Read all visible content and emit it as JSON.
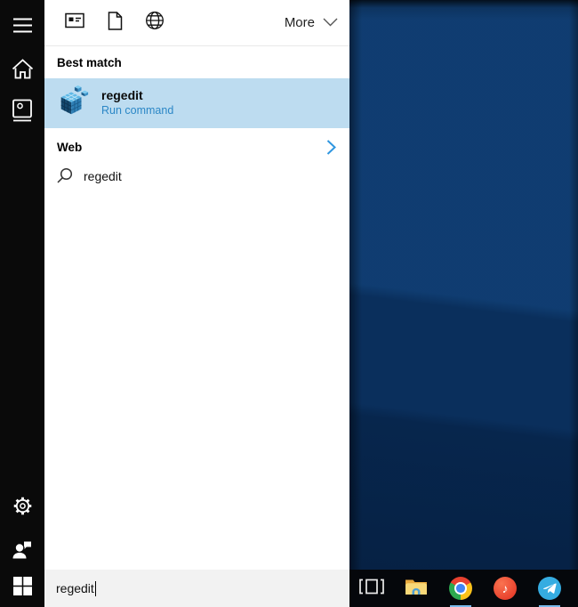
{
  "sidebar": {
    "items": [
      {
        "name": "menu",
        "icon": "hamburger-icon"
      },
      {
        "name": "home",
        "icon": "home-icon"
      },
      {
        "name": "notebook",
        "icon": "notebook-icon"
      },
      {
        "name": "settings",
        "icon": "gear-icon"
      },
      {
        "name": "feedback",
        "icon": "feedback-icon"
      }
    ],
    "start": {
      "name": "start",
      "icon": "windows-logo-icon"
    }
  },
  "topbar": {
    "filters": [
      {
        "icon": "apps-filter-icon"
      },
      {
        "icon": "documents-filter-icon"
      },
      {
        "icon": "web-filter-icon"
      }
    ],
    "more_label": "More",
    "more_icon": "chevron-down-icon"
  },
  "results": {
    "best_match_header": "Best match",
    "best_match": {
      "icon": "registry-editor-icon",
      "title": "regedit",
      "subtitle": "Run command"
    },
    "web_header": "Web",
    "web_expand_icon": "chevron-right-icon",
    "suggestions": [
      {
        "icon": "search-icon",
        "text": "regedit"
      }
    ]
  },
  "search": {
    "value": "regedit"
  },
  "taskbar": {
    "icons": [
      {
        "name": "task-view",
        "running": false
      },
      {
        "name": "file-explorer",
        "running": false
      },
      {
        "name": "chrome",
        "running": true
      },
      {
        "name": "itunes",
        "running": false
      },
      {
        "name": "telegram",
        "running": true
      }
    ],
    "itunes_glyph": "♪"
  },
  "colors": {
    "highlight": "#bddcf0",
    "accent_blue": "#2b87c6",
    "chevron_blue": "#2f96e0",
    "wallpaper_base": "#0a2f5c",
    "taskbar_underline": "#79b9ea",
    "searchbox_bg": "#f2f2f2",
    "sidebar_bg": "#0a0a0a"
  }
}
